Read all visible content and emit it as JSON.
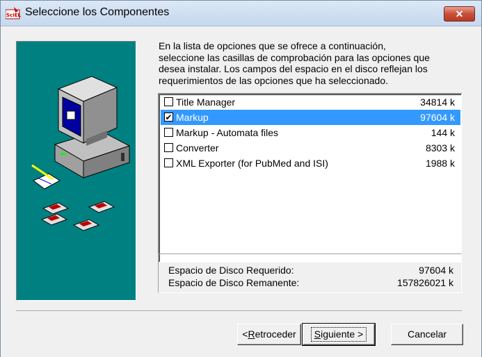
{
  "window": {
    "title": "Seleccione los Componentes",
    "app_icon": "setup-icon",
    "close_icon": "close-icon"
  },
  "description": "En la lista de opciones que se ofrece a continuación,\nseleccione las casillas de comprobación para las opciones que\ndesea instalar. Los campos del espacio en el disco reflejan los\nrequerimientos de las opciones que ha seleccionado.",
  "components": [
    {
      "label": "Title Manager",
      "size": "34814 k",
      "checked": false,
      "selected": false
    },
    {
      "label": "Markup",
      "size": "97604 k",
      "checked": true,
      "selected": true
    },
    {
      "label": "Markup - Automata files",
      "size": "144 k",
      "checked": false,
      "selected": false
    },
    {
      "label": "Converter",
      "size": "8303 k",
      "checked": false,
      "selected": false
    },
    {
      "label": "XML Exporter (for PubMed and ISI)",
      "size": "1988 k",
      "checked": false,
      "selected": false
    }
  ],
  "disk": {
    "required_label": "Espacio de Disco Requerido:",
    "required_value": "97604 k",
    "remaining_label": "Espacio de Disco Remanente:",
    "remaining_value": "157826021 k"
  },
  "buttons": {
    "back_prefix": "<",
    "back_mnemonic": "R",
    "back_rest": "etroceder",
    "next_mnemonic": "S",
    "next_rest": "iguiente >",
    "cancel": "Cancelar"
  },
  "colors": {
    "art_background": "#008080",
    "selection": "#3399ff"
  }
}
